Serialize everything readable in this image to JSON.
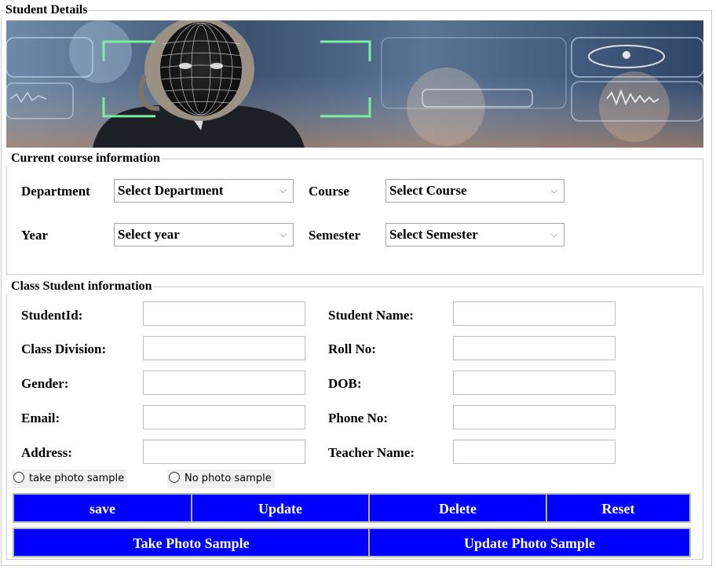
{
  "frame": {
    "title": "Student Details"
  },
  "course": {
    "title": "Current course information",
    "department_label": "Department",
    "department_value": "Select Department",
    "course_label": "Course",
    "course_value": "Select Course",
    "year_label": "Year",
    "year_value": "Select year",
    "semester_label": "Semester",
    "semester_value": "Select Semester"
  },
  "student": {
    "title": "Class Student information",
    "fields_left": [
      "StudentId:",
      "Class Division:",
      "Gender:",
      "Email:",
      "Address:"
    ],
    "fields_right": [
      "Student Name:",
      "Roll No:",
      "DOB:",
      "Phone No:",
      "Teacher Name:"
    ],
    "radio_take": "take photo sample",
    "radio_no": "No photo sample"
  },
  "buttons": {
    "save": "save",
    "update": "Update",
    "delete": "Delete",
    "reset": "Reset",
    "take_photo": "Take Photo Sample",
    "update_photo": "Update Photo Sample"
  },
  "colors": {
    "button_bg": "#0000ff",
    "button_text": "#ffffff",
    "border": "#c9c9c9"
  },
  "icons": {
    "dropdown": "chevron-down-icon",
    "radio": "radio-unchecked-icon"
  }
}
